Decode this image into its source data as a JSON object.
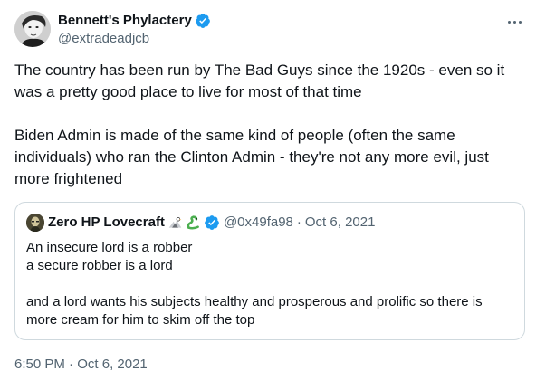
{
  "author": {
    "name": "Bennett's Phylactery",
    "handle": "@extradeadjcb",
    "verified": true
  },
  "tweet": {
    "paragraph1_line1": "The country has been run by The Bad Guys since the 1920s - even so it",
    "paragraph1_line2": "was a pretty good place to live for most of that time",
    "paragraph2_line1": "Biden Admin is made of the same kind of people (often the same",
    "paragraph2_line2": "individuals) who ran the Clinton Admin - they're not any more evil, just",
    "paragraph2_line3": "more frightened"
  },
  "quoted": {
    "name": "Zero HP Lovecraft",
    "emojis": [
      "eagle-emoji",
      "snake-emoji"
    ],
    "verified": true,
    "handle": "@0x49fa98",
    "separator": "·",
    "date": "Oct 6, 2021",
    "line1": "An insecure lord is a robber",
    "line2": "a secure robber is a lord",
    "line3": "and a lord wants his subjects healthy and prosperous and prolific so there is",
    "line4": "more cream for him to skim off the top"
  },
  "timestamp": {
    "time": "6:50 PM",
    "separator": "·",
    "date": "Oct 6, 2021"
  },
  "colors": {
    "text": "#0f1419",
    "secondary": "#536471",
    "verified": "#1d9bf0",
    "border": "#cfd9de"
  }
}
